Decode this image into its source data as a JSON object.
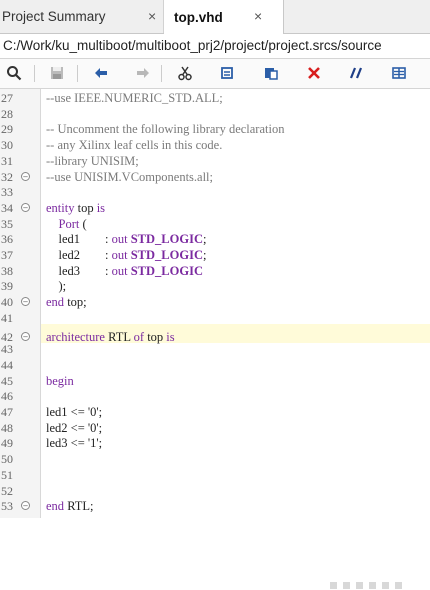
{
  "tabs": [
    {
      "label": "Project Summary",
      "close": "×"
    },
    {
      "label": "top.vhd",
      "close": "×"
    }
  ],
  "path": "C:/Work/ku_multiboot/multiboot_prj2/project/project.srcs/source",
  "toolbar": {
    "icons": [
      "search-icon",
      "save-icon",
      "undo-icon",
      "redo-icon",
      "cut-icon",
      "copy-icon",
      "paste-icon",
      "delete-icon",
      "comment-icon",
      "block-icon"
    ]
  },
  "editor": {
    "lines": [
      {
        "n": "27",
        "segs": [
          {
            "t": "--use IEEE.NUMERIC_STD.ALL;",
            "c": "cmt"
          }
        ]
      },
      {
        "n": "28",
        "segs": []
      },
      {
        "n": "29",
        "segs": [
          {
            "t": "-- Uncomment the following library declaration",
            "c": "cmt"
          }
        ]
      },
      {
        "n": "30",
        "segs": [
          {
            "t": "-- any Xilinx leaf cells in this code.",
            "c": "cmt"
          }
        ]
      },
      {
        "n": "31",
        "segs": [
          {
            "t": "--library UNISIM;",
            "c": "cmt"
          }
        ]
      },
      {
        "n": "32",
        "fold": true,
        "segs": [
          {
            "t": "--use UNISIM.VComponents.all;",
            "c": "cmt"
          }
        ]
      },
      {
        "n": "33",
        "segs": []
      },
      {
        "n": "34",
        "fold": true,
        "segs": [
          {
            "t": "entity",
            "c": "kw"
          },
          {
            "t": " top ",
            "c": ""
          },
          {
            "t": "is",
            "c": "kw"
          }
        ]
      },
      {
        "n": "35",
        "segs": [
          {
            "t": "    Port",
            "c": "kw"
          },
          {
            "t": " (",
            "c": ""
          }
        ]
      },
      {
        "n": "36",
        "segs": [
          {
            "t": "    led1        : ",
            "c": ""
          },
          {
            "t": "out",
            "c": "kw"
          },
          {
            "t": " ",
            "c": ""
          },
          {
            "t": "STD_LOGIC",
            "c": "ty"
          },
          {
            "t": ";",
            "c": ""
          }
        ]
      },
      {
        "n": "37",
        "segs": [
          {
            "t": "    led2        : ",
            "c": ""
          },
          {
            "t": "out",
            "c": "kw"
          },
          {
            "t": " ",
            "c": ""
          },
          {
            "t": "STD_LOGIC",
            "c": "ty"
          },
          {
            "t": ";",
            "c": ""
          }
        ]
      },
      {
        "n": "38",
        "segs": [
          {
            "t": "    led3        : ",
            "c": ""
          },
          {
            "t": "out",
            "c": "kw"
          },
          {
            "t": " ",
            "c": ""
          },
          {
            "t": "STD_LOGIC",
            "c": "ty"
          }
        ]
      },
      {
        "n": "39",
        "segs": [
          {
            "t": "    );",
            "c": ""
          }
        ]
      },
      {
        "n": "40",
        "fold": true,
        "segs": [
          {
            "t": "end",
            "c": "kw"
          },
          {
            "t": " top;",
            "c": ""
          }
        ]
      },
      {
        "n": "41",
        "segs": []
      },
      {
        "n": "42",
        "fold": true,
        "segs": [
          {
            "t": "architecture",
            "c": "kw"
          },
          {
            "t": " RTL ",
            "c": ""
          },
          {
            "t": "of",
            "c": "kw"
          },
          {
            "t": " top ",
            "c": ""
          },
          {
            "t": "is",
            "c": "kw"
          }
        ]
      },
      {
        "n": "43",
        "segs": []
      },
      {
        "n": "44",
        "segs": []
      },
      {
        "n": "45",
        "segs": [
          {
            "t": "begin",
            "c": "kw"
          }
        ]
      },
      {
        "n": "46",
        "segs": []
      },
      {
        "n": "47",
        "segs": [
          {
            "t": "led1 <= '0';",
            "c": ""
          }
        ]
      },
      {
        "n": "48",
        "segs": [
          {
            "t": "led2 <= '0';",
            "c": ""
          }
        ]
      },
      {
        "n": "49",
        "segs": [
          {
            "t": "led3 <= '1';",
            "c": ""
          }
        ]
      },
      {
        "n": "50",
        "segs": []
      },
      {
        "n": "51",
        "segs": []
      },
      {
        "n": "52",
        "segs": []
      },
      {
        "n": "53",
        "fold": true,
        "segs": [
          {
            "t": "end",
            "c": "kw"
          },
          {
            "t": " RTL;",
            "c": ""
          }
        ]
      }
    ]
  },
  "colors": {
    "keyword": "#7b2aa0",
    "comment": "#7a7a7a",
    "highlight": "#fffbd9"
  }
}
